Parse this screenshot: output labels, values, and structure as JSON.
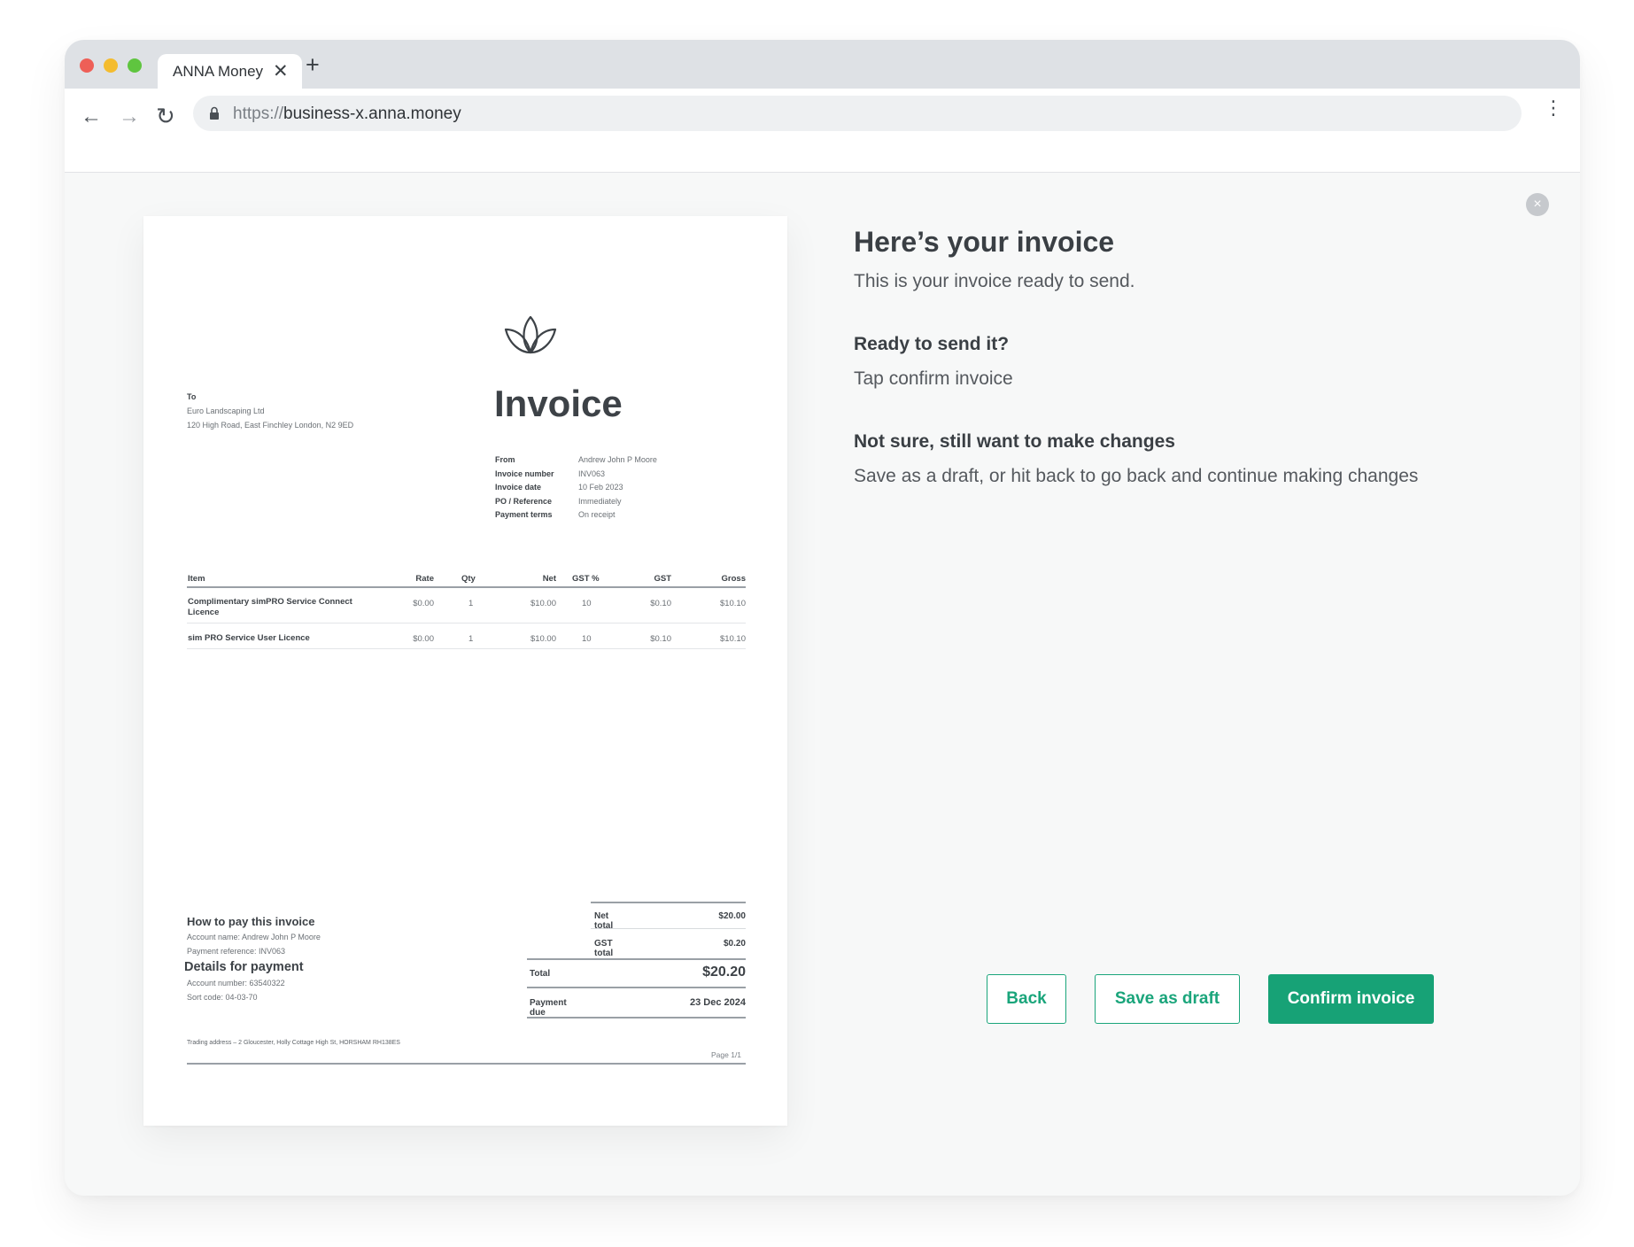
{
  "browser": {
    "tab_title": "ANNA Money",
    "tab_close": "✕",
    "new_tab": "+",
    "url_scheme": "https://",
    "url_host": "business-x.anna.money"
  },
  "invoice": {
    "title": "Invoice",
    "to_label": "To",
    "to_name": "Euro Landscaping Ltd",
    "to_address": "120 High Road, East Finchley London, N2 9ED",
    "meta": [
      {
        "label": "From",
        "value": "Andrew John P Moore"
      },
      {
        "label": "Invoice number",
        "value": "INV063"
      },
      {
        "label": "Invoice date",
        "value": "10 Feb 2023"
      },
      {
        "label": "PO / Reference",
        "value": "Immediately"
      },
      {
        "label": "Payment terms",
        "value": "On receipt"
      }
    ],
    "columns": {
      "item": "Item",
      "rate": "Rate",
      "qty": "Qty",
      "net": "Net",
      "gst_pct": "GST %",
      "gst": "GST",
      "gross": "Gross"
    },
    "rows": [
      {
        "item": "Complimentary simPRO Service Connect Licence",
        "rate": "$0.00",
        "qty": "1",
        "net": "$10.00",
        "gst_pct": "10",
        "gst": "$0.10",
        "gross": "$10.10"
      },
      {
        "item": "sim PRO Service User Licence",
        "rate": "$0.00",
        "qty": "1",
        "net": "$10.00",
        "gst_pct": "10",
        "gst": "$0.10",
        "gross": "$10.10"
      }
    ],
    "how_title": "How to pay this invoice",
    "account_name": "Account name: Andrew John P Moore",
    "payment_reference": "Payment reference: INV063",
    "details_title": "Details for payment",
    "account_number": "Account number: 63540322",
    "sort_code": "Sort code: 04-03-70",
    "totals": {
      "net_label": "Net total",
      "net_value": "$20.00",
      "gst_label": "GST total",
      "gst_value": "$0.20",
      "total_label": "Total",
      "total_value": "$20.20",
      "due_label": "Payment due",
      "due_value": "23 Dec 2024"
    },
    "trading_address": "Trading address – 2 Gloucester, Holly Cottage High St, HORSHAM RH138ES",
    "page": "Page 1/1"
  },
  "panel": {
    "title": "Here’s your invoice",
    "subtitle": "This is your invoice ready to send.",
    "ready_heading": "Ready to send it?",
    "ready_text": "Tap confirm invoice",
    "notsure_heading": "Not sure, still want to make changes",
    "notsure_text": "Save as a draft, or hit back to go back and continue making changes"
  },
  "actions": {
    "back": "Back",
    "save_draft": "Save as draft",
    "confirm": "Confirm invoice"
  },
  "colors": {
    "accent": "#17a276"
  }
}
